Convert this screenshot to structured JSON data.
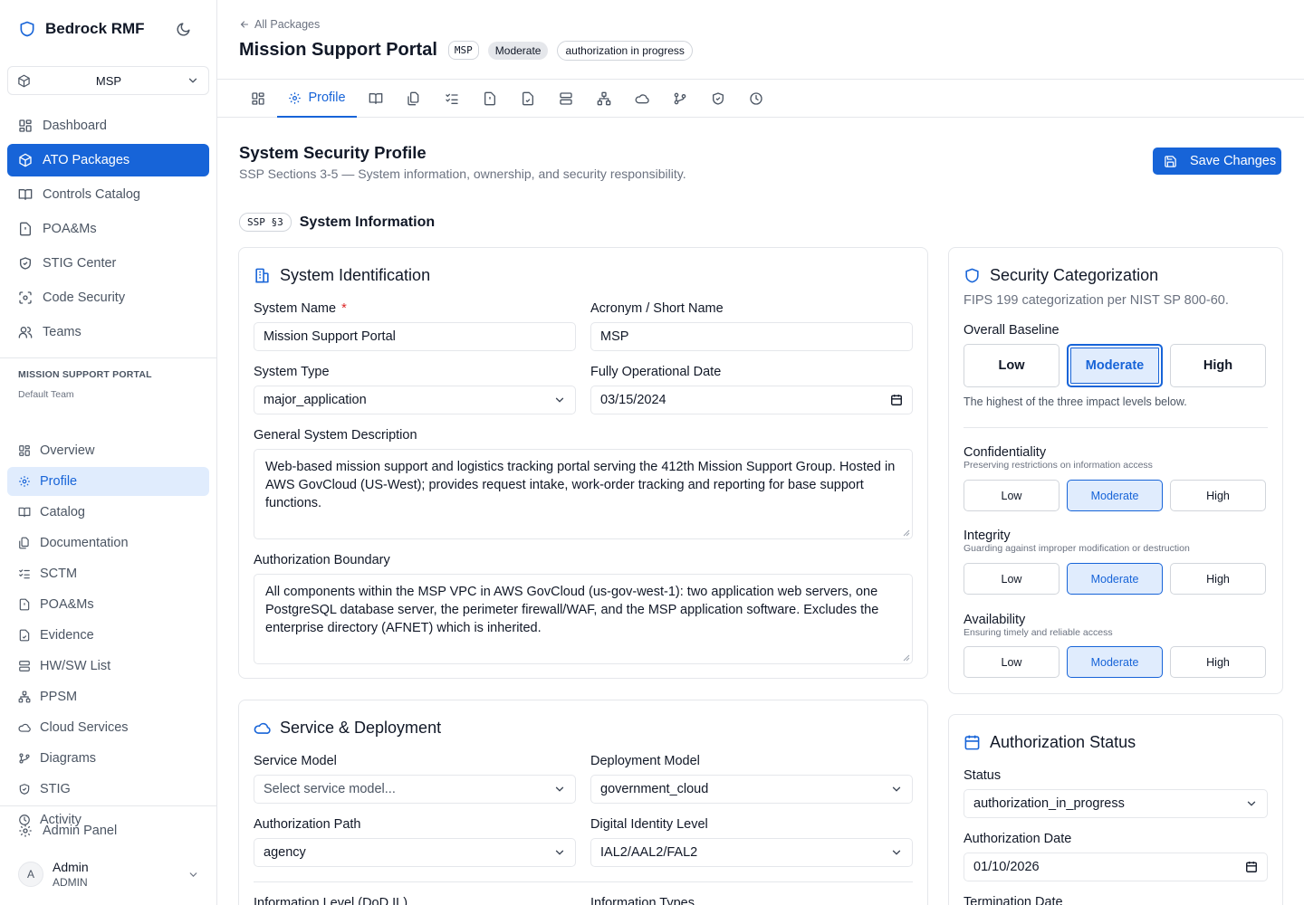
{
  "brand": {
    "name": "Bedrock RMF"
  },
  "package_select": {
    "value": "MSP"
  },
  "nav": {
    "items": [
      {
        "label": "Dashboard",
        "icon": "dashboard-icon"
      },
      {
        "label": "ATO Packages",
        "icon": "package-icon"
      },
      {
        "label": "Controls Catalog",
        "icon": "book-icon"
      },
      {
        "label": "POA&Ms",
        "icon": "file-alert-icon"
      },
      {
        "label": "STIG Center",
        "icon": "shield-check-icon"
      },
      {
        "label": "Code Security",
        "icon": "scan-code-icon"
      },
      {
        "label": "Teams",
        "icon": "users-icon"
      }
    ]
  },
  "package_section": {
    "title": "MISSION SUPPORT PORTAL",
    "team": "Default Team",
    "items": [
      {
        "label": "Overview"
      },
      {
        "label": "Profile"
      },
      {
        "label": "Catalog"
      },
      {
        "label": "Documentation"
      },
      {
        "label": "SCTM"
      },
      {
        "label": "POA&Ms"
      },
      {
        "label": "Evidence"
      },
      {
        "label": "HW/SW List"
      },
      {
        "label": "PPSM"
      },
      {
        "label": "Cloud Services"
      },
      {
        "label": "Diagrams"
      },
      {
        "label": "STIG"
      },
      {
        "label": "Activity"
      }
    ]
  },
  "admin_panel": {
    "label": "Admin Panel"
  },
  "user": {
    "initial": "A",
    "name": "Admin",
    "role": "ADMIN"
  },
  "header": {
    "back_label": "All Packages",
    "title": "Mission Support Portal",
    "badge_acronym": "MSP",
    "badge_baseline": "Moderate",
    "badge_status": "authorization in progress"
  },
  "tabs": {
    "active_label": "Profile"
  },
  "page": {
    "title": "System Security Profile",
    "subtitle": "SSP Sections 3-5 — System information, ownership, and security responsibility.",
    "save_label": "Save Changes",
    "section_code": "SSP §3",
    "section_label": "System Information"
  },
  "identification": {
    "title": "System Identification",
    "name_label": "System Name",
    "name_required": "*",
    "name_value": "Mission Support Portal",
    "acronym_label": "Acronym / Short Name",
    "acronym_value": "MSP",
    "type_label": "System Type",
    "type_value": "major_application",
    "date_label": "Fully Operational Date",
    "date_value": "03/15/2024",
    "desc_label": "General System Description",
    "desc_value": "Web-based mission support and logistics tracking portal serving the 412th Mission Support Group. Hosted in AWS GovCloud (US-West); provides request intake, work-order tracking and reporting for base support functions.",
    "boundary_label": "Authorization Boundary",
    "boundary_value": "All components within the MSP VPC in AWS GovCloud (us-gov-west-1): two application web servers, one PostgreSQL database server, the perimeter firewall/WAF, and the MSP application software. Excludes the enterprise directory (AFNET) which is inherited."
  },
  "deployment": {
    "title": "Service & Deployment",
    "service_label": "Service Model",
    "service_placeholder": "Select service model...",
    "deploy_label": "Deployment Model",
    "deploy_value": "government_cloud",
    "path_label": "Authorization Path",
    "path_value": "agency",
    "identity_label": "Digital Identity Level",
    "identity_value": "IAL2/AAL2/FAL2",
    "info_level_label": "Information Level (DoD IL)",
    "info_types_label": "Information Types"
  },
  "categorization": {
    "title": "Security Categorization",
    "subtitle": "FIPS 199 categorization per NIST SP 800-60.",
    "overall_label": "Overall Baseline",
    "overall_selected": "Moderate",
    "overall_hint": "The highest of the three impact levels below.",
    "levels": [
      "Low",
      "Moderate",
      "High"
    ],
    "confidentiality": {
      "label": "Confidentiality",
      "desc": "Preserving restrictions on information access",
      "selected": "Moderate"
    },
    "integrity": {
      "label": "Integrity",
      "desc": "Guarding against improper modification or destruction",
      "selected": "Moderate"
    },
    "availability": {
      "label": "Availability",
      "desc": "Ensuring timely and reliable access",
      "selected": "Moderate"
    }
  },
  "authorization": {
    "title": "Authorization Status",
    "status_label": "Status",
    "status_value": "authorization_in_progress",
    "date_label": "Authorization Date",
    "date_value": "01/10/2026",
    "termination_label": "Termination Date"
  },
  "colors": {
    "accent": "#1764d8",
    "accent_soft": "#e0ecfd",
    "border": "#e5e7eb",
    "required": "#dc2626"
  }
}
